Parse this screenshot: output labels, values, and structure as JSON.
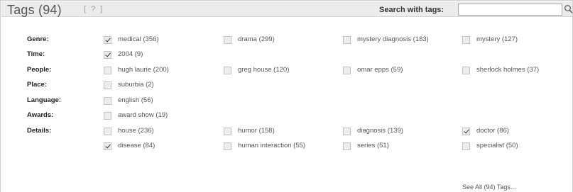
{
  "header": {
    "title": "Tags (94)",
    "help_link": "[ ? ]",
    "search_label": "Search with tags:",
    "search_value": "",
    "search_placeholder": "",
    "search_icon": "magnifier-icon"
  },
  "rows": [
    {
      "label": "Genre:",
      "tags": [
        {
          "text": "medical (356)",
          "checked": true
        },
        {
          "text": "drama (299)",
          "checked": false
        },
        {
          "text": "mystery diagnosis (183)",
          "checked": false
        },
        {
          "text": "mystery (127)",
          "checked": false
        }
      ]
    },
    {
      "label": "Time:",
      "tags": [
        {
          "text": "2004 (9)",
          "checked": true
        }
      ]
    },
    {
      "label": "People:",
      "tags": [
        {
          "text": "hugh laurie (200)",
          "checked": false
        },
        {
          "text": "greg house (120)",
          "checked": false
        },
        {
          "text": "omar epps (59)",
          "checked": false
        },
        {
          "text": "sherlock holmes (37)",
          "checked": false
        }
      ]
    },
    {
      "label": "Place:",
      "tags": [
        {
          "text": "suburbia (2)",
          "checked": false
        }
      ]
    },
    {
      "label": "Language:",
      "tags": [
        {
          "text": "english (56)",
          "checked": false
        }
      ]
    },
    {
      "label": "Awards:",
      "tags": [
        {
          "text": "award show (19)",
          "checked": false
        }
      ]
    },
    {
      "label": "Details:",
      "tags": [
        {
          "text": "house (236)",
          "checked": false
        },
        {
          "text": "humor (158)",
          "checked": false
        },
        {
          "text": "diagnosis (139)",
          "checked": false
        },
        {
          "text": "doctor (86)",
          "checked": true
        }
      ]
    },
    {
      "label": "",
      "tags": [
        {
          "text": "disease (84)",
          "checked": true
        },
        {
          "text": "human interaction (55)",
          "checked": false
        },
        {
          "text": "series (51)",
          "checked": false
        },
        {
          "text": "specialist (50)",
          "checked": false
        }
      ]
    }
  ],
  "footer": {
    "see_all": "See All (94) Tags..."
  }
}
